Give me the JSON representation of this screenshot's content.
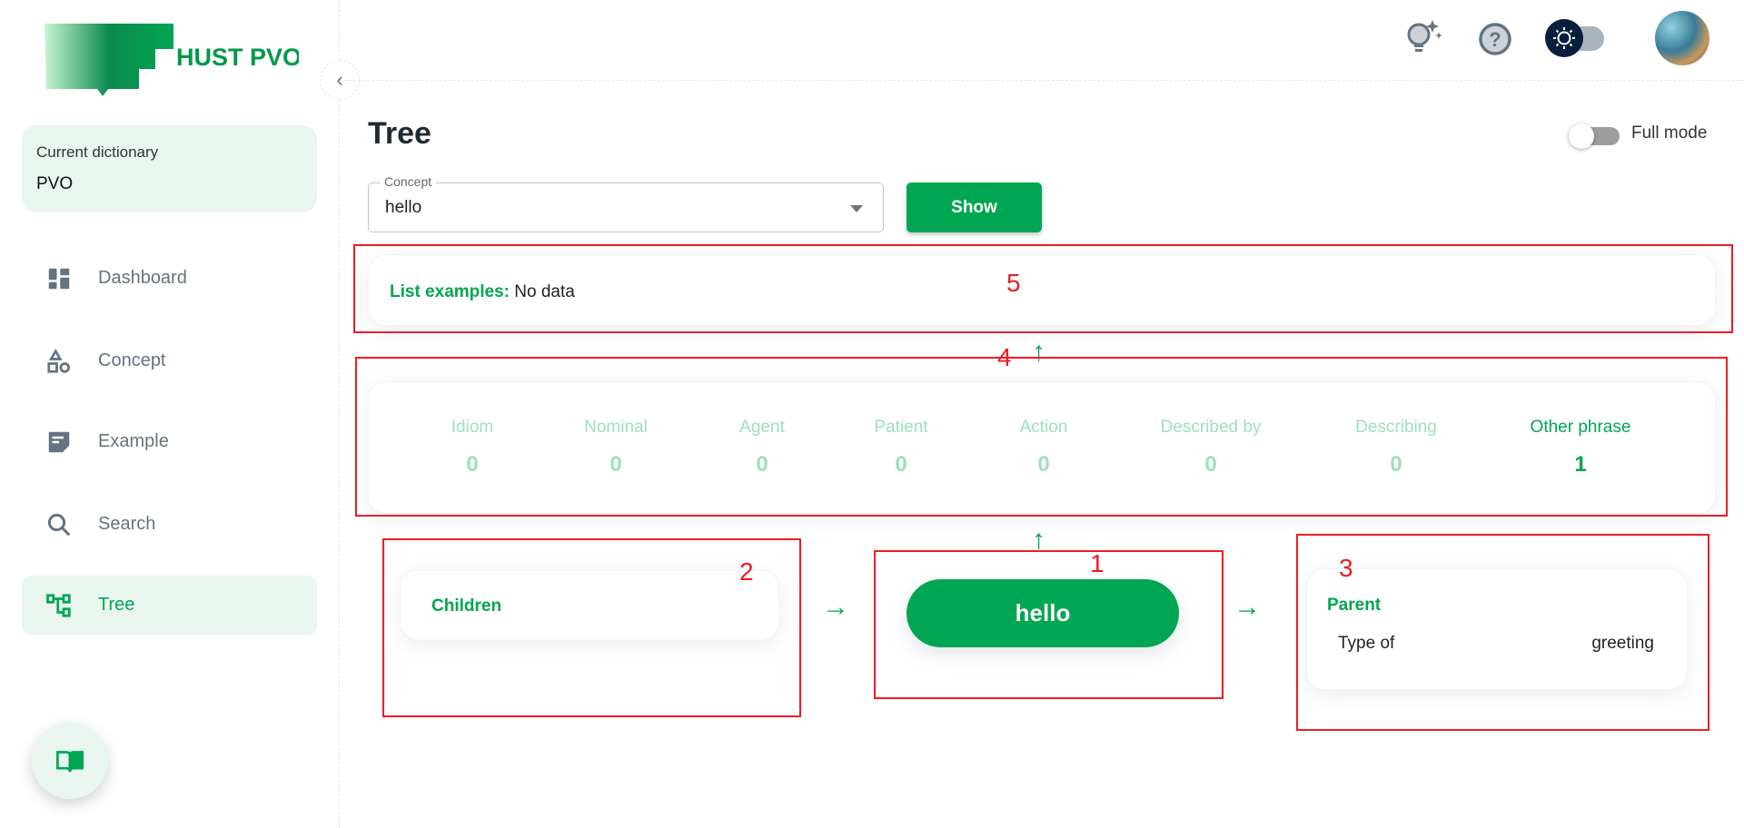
{
  "brand": {
    "name": "HUST PVO",
    "colors": {
      "primary": "#00a651",
      "light": "#e9f6ef",
      "annotation": "#ed1c24"
    }
  },
  "sidebar": {
    "current_dictionary_label": "Current dictionary",
    "current_dictionary_value": "PVO",
    "items": [
      {
        "label": "Dashboard",
        "icon": "dashboard-icon"
      },
      {
        "label": "Concept",
        "icon": "shapes-icon"
      },
      {
        "label": "Example",
        "icon": "note-icon"
      },
      {
        "label": "Search",
        "icon": "search-icon"
      },
      {
        "label": "Tree",
        "icon": "tree-icon",
        "active": true
      }
    ]
  },
  "header": {
    "icons": [
      "lightbulb-sparkle-icon",
      "help-icon",
      "theme-toggle-sun-icon",
      "avatar"
    ]
  },
  "page": {
    "title": "Tree",
    "full_mode_label": "Full mode",
    "full_mode_on": false,
    "concept_label": "Concept",
    "concept_value": "hello",
    "show_label": "Show"
  },
  "examples": {
    "label": "List examples:",
    "value": "No data"
  },
  "stats": [
    {
      "label": "Idiom",
      "value": "0"
    },
    {
      "label": "Nominal",
      "value": "0"
    },
    {
      "label": "Agent",
      "value": "0"
    },
    {
      "label": "Patient",
      "value": "0"
    },
    {
      "label": "Action",
      "value": "0"
    },
    {
      "label": "Described by",
      "value": "0"
    },
    {
      "label": "Describing",
      "value": "0"
    },
    {
      "label": "Other phrase",
      "value": "1"
    }
  ],
  "tree": {
    "node": "hello",
    "children_label": "Children",
    "parent_label": "Parent",
    "parent_relation": "Type of",
    "parent_value": "greeting"
  },
  "annotations": [
    "1",
    "2",
    "3",
    "4",
    "5"
  ]
}
